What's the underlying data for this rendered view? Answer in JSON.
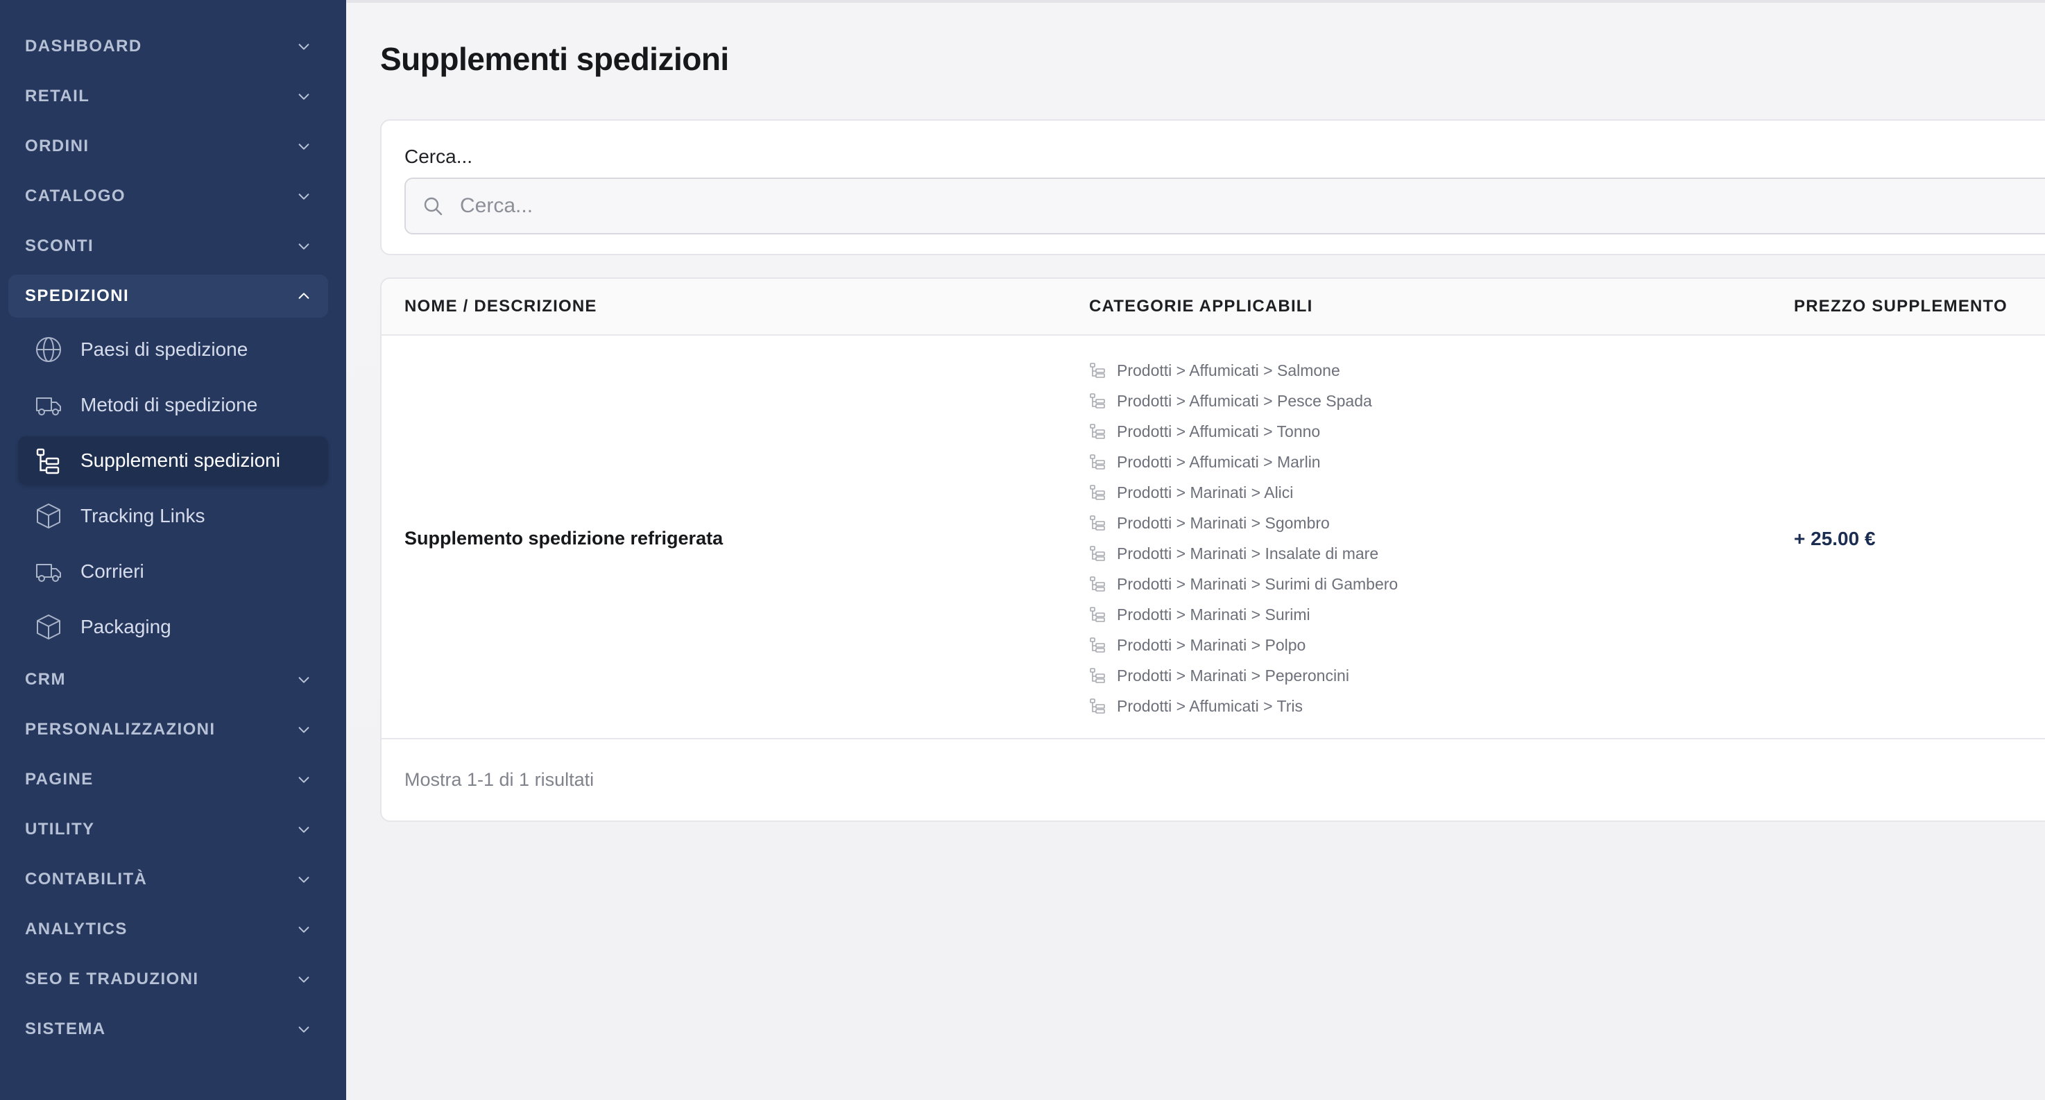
{
  "sidebar": {
    "groups_top": [
      {
        "label": "DASHBOARD"
      },
      {
        "label": "RETAIL"
      },
      {
        "label": "ORDINI"
      },
      {
        "label": "CATALOGO"
      },
      {
        "label": "SCONTI"
      }
    ],
    "active_group": {
      "label": "SPEDIZIONI"
    },
    "sub_items": [
      {
        "label": "Paesi di spedizione",
        "icon": "globe-icon"
      },
      {
        "label": "Metodi di spedizione",
        "icon": "truck-icon"
      },
      {
        "label": "Supplementi spedizioni",
        "icon": "hierarchy-icon",
        "active": true
      },
      {
        "label": "Tracking Links",
        "icon": "box-icon"
      },
      {
        "label": "Corrieri",
        "icon": "truck-icon"
      },
      {
        "label": "Packaging",
        "icon": "box-icon"
      }
    ],
    "groups_bottom": [
      {
        "label": "CRM"
      },
      {
        "label": "PERSONALIZZAZIONI"
      },
      {
        "label": "PAGINE"
      },
      {
        "label": "UTILITY"
      },
      {
        "label": "CONTABILITÀ"
      },
      {
        "label": "ANALYTICS"
      },
      {
        "label": "SEO E TRADUZIONI"
      },
      {
        "label": "SISTEMA"
      }
    ]
  },
  "main": {
    "title": "Supplementi spedizioni",
    "search": {
      "label": "Cerca...",
      "placeholder": "Cerca...",
      "value": ""
    },
    "table": {
      "columns": [
        "NOME / DESCRIZIONE",
        "CATEGORIE APPLICABILI",
        "PREZZO SUPPLEMENTO"
      ],
      "rows": [
        {
          "name": "Supplemento spedizione refrigerata",
          "categories": [
            "Prodotti > Affumicati > Salmone",
            "Prodotti > Affumicati > Pesce Spada",
            "Prodotti > Affumicati > Tonno",
            "Prodotti > Affumicati > Marlin",
            "Prodotti > Marinati > Alici",
            "Prodotti > Marinati > Sgombro",
            "Prodotti > Marinati > Insalate di mare",
            "Prodotti > Marinati > Surimi di Gambero",
            "Prodotti > Marinati > Surimi",
            "Prodotti > Marinati > Polpo",
            "Prodotti > Marinati > Peperoncini",
            "Prodotti > Affumicati > Tris"
          ],
          "price": "+ 25.00 €"
        }
      ],
      "footer": "Mostra 1-1 di 1 risultati"
    }
  },
  "colors": {
    "sidebar_bg": "#26385e",
    "accent": "#1c2d52"
  }
}
